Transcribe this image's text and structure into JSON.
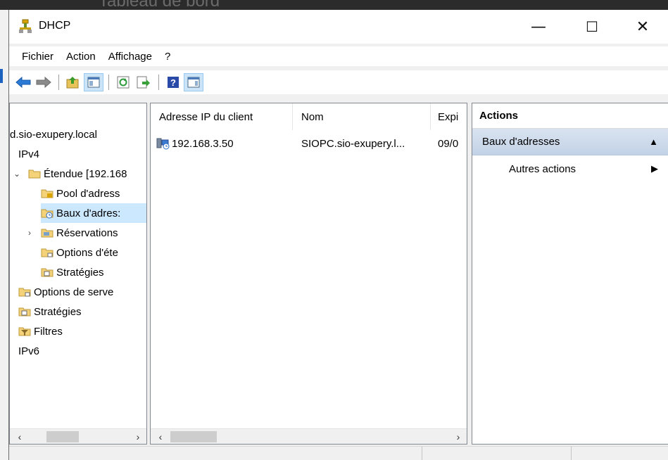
{
  "background": {
    "title_fragment": "Tableau de bord"
  },
  "window": {
    "title": "DHCP",
    "controls": {
      "minimize": "—",
      "maximize": "☐",
      "close": "✕"
    }
  },
  "menu": [
    "Fichier",
    "Action",
    "Affichage",
    "?"
  ],
  "toolbar": [
    "back-arrow-icon",
    "forward-arrow-icon",
    "up-folder-icon",
    "show-hide-tree-icon",
    "refresh-icon",
    "export-list-icon",
    "help-icon",
    "show-hide-action-pane-icon"
  ],
  "tree": {
    "root": "",
    "server": "d.sio-exupery.local",
    "ipv4": "IPv4",
    "scope": "Étendue [192.168",
    "pool": "Pool d'adress",
    "leases": "Baux d'adres:",
    "reservations": "Réservations",
    "scope_options": "Options d'éte",
    "scope_policies": "Stratégies",
    "server_options": "Options de serve",
    "policies": "Stratégies",
    "filters": "Filtres",
    "ipv6": "IPv6"
  },
  "list": {
    "columns": [
      "Adresse IP du client",
      "Nom",
      "Expi"
    ],
    "rows": [
      {
        "ip": "192.168.3.50",
        "name": "SIOPC.sio-exupery.l...",
        "expiry": "09/0"
      }
    ]
  },
  "actions": {
    "header": "Actions",
    "section": "Baux d'adresses",
    "more": "Autres actions"
  },
  "colors": {
    "selected": "#cce8ff",
    "action_section": "#c9d7ea",
    "toolbar_pressed": "#cce4f7"
  }
}
